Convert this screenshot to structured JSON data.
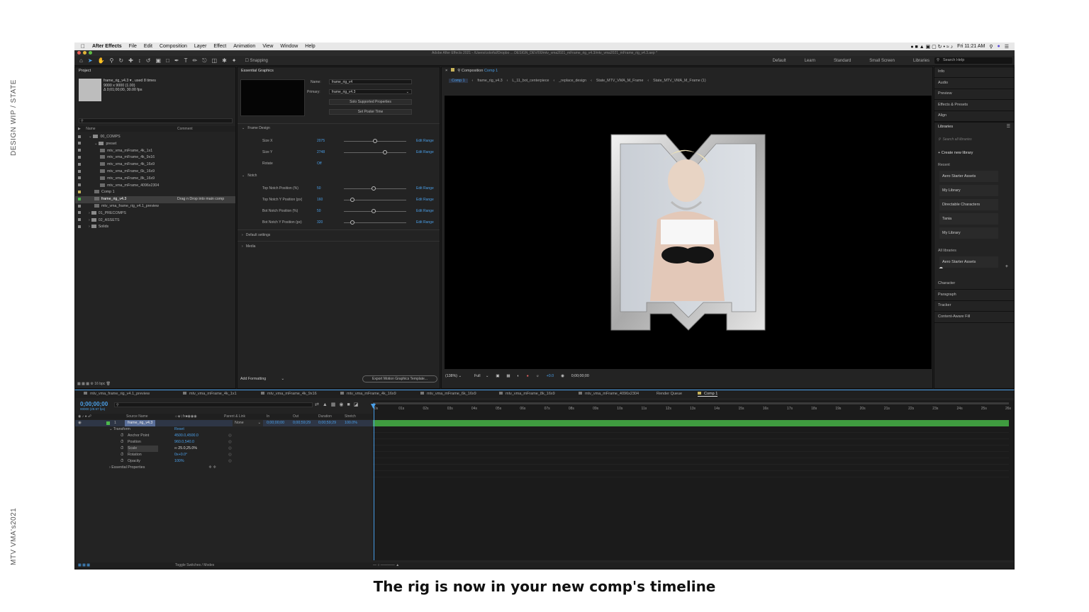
{
  "side_labels": {
    "top": "DESIGN WIP / STATE",
    "bottom": "MTV VMA's2021"
  },
  "caption": "The rig is now in your new comp's timeline",
  "menubar": {
    "app_name": "After Effects",
    "items": [
      "File",
      "Edit",
      "Composition",
      "Layer",
      "Effect",
      "Animation",
      "View",
      "Window",
      "Help"
    ],
    "clock": "Fri 11:21 AM"
  },
  "titlebar": "Adobe After Effects 2021 - /Users/colorful/Dropbo ... DESIGN_DEV/00/mtv_vma2021_mFrame_rig_v4.3/mtv_vma2021_mFrame_rig_v4.3.aep *",
  "toolbar": {
    "snapping": "Snapping",
    "workspaces": [
      "Default",
      "Learn",
      "Standard",
      "Small Screen",
      "Libraries"
    ],
    "search_help": "Search Help"
  },
  "project": {
    "title": "Project",
    "selected_name": "frame_rig_v4.3 ▾ , used 8 times",
    "selected_dims": "9000 x 9000 (1.00)",
    "selected_dur": "Δ 0;01;00;00, 30.00 fps",
    "col_name": "Name",
    "col_comment": "Comment",
    "items": [
      {
        "label": "00_COMPS",
        "indent": 1,
        "kind": "folder",
        "color": "#8b8b8b"
      },
      {
        "label": "preset",
        "indent": 2,
        "kind": "folder",
        "color": "#8b8b8b"
      },
      {
        "label": "mtv_vma_mFrame_4k_1x1",
        "indent": 3,
        "kind": "comp",
        "color": "#8b8b8b"
      },
      {
        "label": "mtv_vma_mFrame_4k_9x16",
        "indent": 3,
        "kind": "comp",
        "color": "#8b8b8b"
      },
      {
        "label": "mtv_vma_mFrame_4k_16x9",
        "indent": 3,
        "kind": "comp",
        "color": "#8b8b8b"
      },
      {
        "label": "mtv_vma_mFrame_6k_16x9",
        "indent": 3,
        "kind": "comp",
        "color": "#8b8b8b"
      },
      {
        "label": "mtv_vma_mFrame_8k_16x9",
        "indent": 3,
        "kind": "comp",
        "color": "#8b8b8b"
      },
      {
        "label": "mtv_vma_mFrame_4096x2304",
        "indent": 3,
        "kind": "comp",
        "color": "#8b8b8b"
      },
      {
        "label": "Comp 1",
        "indent": 2,
        "kind": "comp",
        "color": "#c8b35a"
      },
      {
        "label": "frame_rig_v4.3",
        "indent": 2,
        "kind": "comp",
        "color": "#4db84d",
        "selected": true,
        "comment": "Drag n Drop into main comp"
      },
      {
        "label": "mtv_vma_frame_rig_v4.1_preview",
        "indent": 2,
        "kind": "comp",
        "color": "#8b8b8b"
      },
      {
        "label": "01_PRECOMPS",
        "indent": 1,
        "kind": "folder",
        "color": "#8b8b8b"
      },
      {
        "label": "02_ASSETS",
        "indent": 1,
        "kind": "folder",
        "color": "#8b8b8b"
      },
      {
        "label": "Solids",
        "indent": 1,
        "kind": "folder",
        "color": "#8b8b8b"
      }
    ],
    "bpc": "16 bpc"
  },
  "essential_graphics": {
    "title": "Essential Graphics",
    "name_label": "Name:",
    "name_value": "frame_rig_v4",
    "primary_label": "Primary:",
    "primary_value": "frame_rig_v4.3",
    "solo_btn": "Solo Supported Properties",
    "poster_btn": "Set Poster Time",
    "section_frame": "Frame Design",
    "section_notch": "Notch",
    "section_default": "Default settings",
    "section_media": "Media",
    "edit_range": "Edit Range",
    "props": [
      {
        "label": "Size X",
        "value": "2075",
        "knob": 0.5
      },
      {
        "label": "Size Y",
        "value": "2748",
        "knob": 0.66
      },
      {
        "label": "Rotate",
        "value": "Off"
      },
      {
        "label": "Top Notch Position (%)",
        "value": "50",
        "knob": 0.48
      },
      {
        "label": "Top Notch Y Position (px)",
        "value": "160",
        "knob": 0.14
      },
      {
        "label": "Bot Notch Position (%)",
        "value": "50",
        "knob": 0.48
      },
      {
        "label": "Bot Notch Y Position (px)",
        "value": "320",
        "knob": 0.14
      }
    ],
    "add_formatting": "Add Formatting",
    "export_btn": "Export Motion Graphics Template..."
  },
  "composition": {
    "title": "Composition",
    "comp_name": "Comp 1",
    "breadcrumbs": [
      "Comp 1",
      "frame_rig_v4.3",
      "L_11_bot_centerpiece",
      "_replace_design",
      "State_MTV_VMA_M_Frame",
      "State_MTV_VMA_M_Frame (1)"
    ],
    "zoom": "(138%)",
    "resolution": "Full",
    "exposure": "+0.0",
    "timecode": "0;00;00;00"
  },
  "right_panel": {
    "panels_top": [
      "Info",
      "Audio",
      "Preview",
      "Effects & Presets",
      "Align"
    ],
    "libraries_title": "Libraries",
    "search_placeholder": "Search all libraries",
    "create_new": "Create new library",
    "recent_label": "Recent",
    "recent": [
      "Aero Starter Assets",
      "My Library",
      "Directable Characters",
      "Tania",
      "My Library"
    ],
    "all_label": "All libraries",
    "all": [
      "Aero Starter Assets"
    ],
    "panels_bottom": [
      "Character",
      "Paragraph",
      "Tracker",
      "Content-Aware Fill"
    ]
  },
  "timeline": {
    "tabs": [
      "mtv_vma_frame_rig_v4.1_preview",
      "mtv_vma_mFrame_4k_1x1",
      "mtv_vma_mFrame_4k_9x16",
      "mtv_vma_mFrame_4k_16x9",
      "mtv_vma_mFrame_6k_16x9",
      "mtv_vma_mFrame_8k_16x9",
      "mtv_vma_mFrame_4096x2304",
      "Render Queue",
      "Comp 1"
    ],
    "timecode": "0;00;00;00",
    "frame_info": "00000 (29.97 fps)",
    "cols": {
      "source": "Source Name",
      "parent": "Parent & Link",
      "in": "In",
      "out": "Out",
      "duration": "Duration",
      "stretch": "Stretch"
    },
    "layer": {
      "num": "1",
      "name": "frame_rig_v4.3",
      "parent": "None",
      "in": "0;00;00;00",
      "out": "0;00;59;29",
      "duration": "0;00;59;29",
      "stretch": "100.0%"
    },
    "transform": "Transform",
    "reset": "Reset",
    "props": [
      {
        "label": "Anchor Point",
        "value": "4500.0,4500.0"
      },
      {
        "label": "Position",
        "value": "960.0,540.0"
      },
      {
        "label": "Scale",
        "value": "∞ 25.0,25.0%"
      },
      {
        "label": "Rotation",
        "value": "0x+0.0°"
      },
      {
        "label": "Opacity",
        "value": "100%"
      }
    ],
    "essential_props": "Essential Properties",
    "ruler": [
      "0s",
      "01s",
      "02s",
      "03s",
      "04s",
      "05s",
      "06s",
      "07s",
      "08s",
      "09s",
      "10s",
      "11s",
      "12s",
      "13s",
      "14s",
      "15s",
      "16s",
      "17s",
      "18s",
      "19s",
      "20s",
      "21s",
      "22s",
      "23s",
      "24s",
      "25s",
      "26s"
    ],
    "toggle": "Toggle Switches / Modes"
  },
  "colors": {
    "accent": "#4a9fe8",
    "layer_bar": "#3f9b3f",
    "panel": "#232323"
  }
}
